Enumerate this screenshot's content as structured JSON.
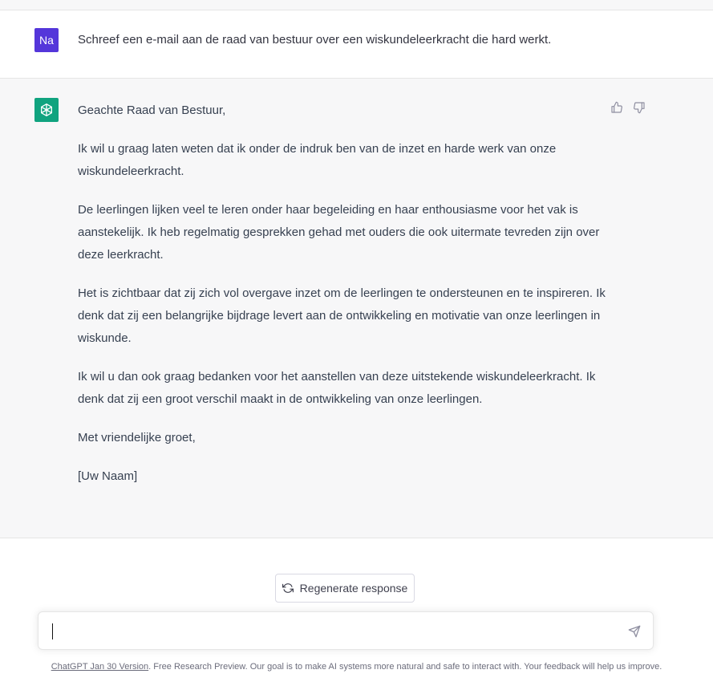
{
  "conversation": {
    "user": {
      "avatar_initials": "Na",
      "avatar_color": "#5436da",
      "message": "Schreef een e-mail aan de raad van bestuur over een wiskundeleerkracht die hard werkt."
    },
    "assistant": {
      "avatar_icon": "openai-logo-icon",
      "avatar_color": "#10a37f",
      "paragraphs": [
        "Geachte Raad van Bestuur,",
        "Ik wil u graag laten weten dat ik onder de indruk ben van de inzet en harde werk van onze wiskundeleerkracht.",
        "De leerlingen lijken veel te leren onder haar begeleiding en haar enthousiasme voor het vak is aanstekelijk. Ik heb regelmatig gesprekken gehad met ouders die ook uitermate tevreden zijn over deze leerkracht.",
        "Het is zichtbaar dat zij zich vol overgave inzet om de leerlingen te ondersteunen en te inspireren. Ik denk dat zij een belangrijke bijdrage levert aan de ontwikkeling en motivatie van onze leerlingen in wiskunde.",
        "Ik wil u dan ook graag bedanken voor het aanstellen van deze uitstekende wiskundeleerkracht. Ik denk dat zij een groot verschil maakt in de ontwikkeling van onze leerlingen.",
        "Met vriendelijke groet,",
        "[Uw Naam]"
      ],
      "feedback_icons": [
        "thumbs-up-icon",
        "thumbs-down-icon"
      ]
    }
  },
  "controls": {
    "regenerate_label": "Regenerate response",
    "regenerate_icon": "refresh-icon",
    "input_placeholder": "",
    "send_icon": "send-icon"
  },
  "footer": {
    "link_text": "ChatGPT Jan 30 Version",
    "text": ". Free Research Preview. Our goal is to make AI systems more natural and safe to interact with. Your feedback will help us improve."
  }
}
